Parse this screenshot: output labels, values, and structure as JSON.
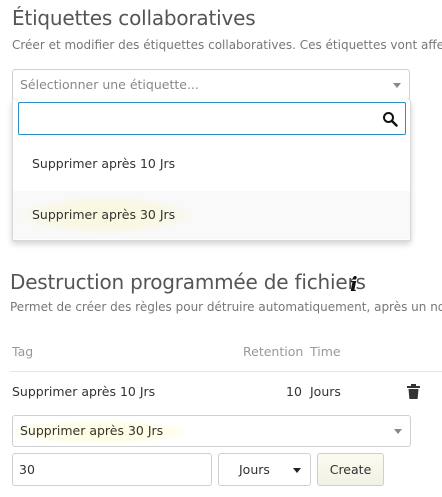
{
  "collab_tags": {
    "title": "Étiquettes collaboratives",
    "description": "Créer et modifier des étiquettes collaboratives. Ces étiquettes vont affec",
    "select_placeholder": "Sélectionner une étiquette...",
    "search_value": "",
    "options": [
      {
        "label": "Supprimer après 10 Jrs"
      },
      {
        "label": "Supprimer après 30 Jrs"
      }
    ]
  },
  "retention": {
    "title": "Destruction programmée de fichiers",
    "info_glyph": "i",
    "description": "Permet de créer des règles pour détruire automatiquement, après un no",
    "columns": {
      "tag": "Tag",
      "retention": "Retention",
      "time": "Time"
    },
    "rows": [
      {
        "tag": "Supprimer après 10 Jrs",
        "retention": "10",
        "time": "Jours"
      }
    ],
    "new_rule": {
      "tag_selected": "Supprimer après 30 Jrs",
      "amount": "30",
      "unit": "Jours",
      "create_label": "Create"
    }
  },
  "icons": {
    "search": "search-icon",
    "delete": "trash-icon",
    "info": "info-icon"
  },
  "colors": {
    "focus_border": "#2a8ec9",
    "highlight": "#fffaaa",
    "hover_row": "#f5f5f5"
  }
}
